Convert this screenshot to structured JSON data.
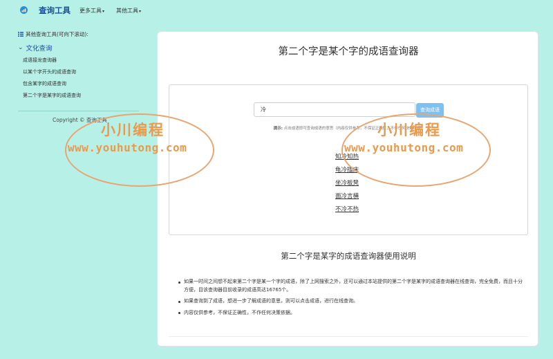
{
  "navbar": {
    "brand": "查询工具",
    "menus": [
      {
        "label": "更多工具"
      },
      {
        "label": "其他工具"
      }
    ]
  },
  "sidebar": {
    "hint": "其他查询工具(可向下滚动):",
    "group_label": "文化查询",
    "links": [
      {
        "label": "成语接龙查询器"
      },
      {
        "label": "以某个字开头的成语查询"
      },
      {
        "label": "包含某字的成语查询"
      },
      {
        "label": "第二个字是某字的成语查询"
      }
    ],
    "copyright": "Copyright © 查询工具"
  },
  "main": {
    "title": "第二个字是某个字的成语查询器",
    "search": {
      "value": "冷",
      "button_label": "查询成语"
    },
    "tip_label": "提示:",
    "tip_text": "点击成语即可查询成语的意思（内容仅供参考，不保证正确性，不作任何决策依据）",
    "results": [
      "知冷知热",
      "龟冷搘床",
      "坐冷板凳",
      "面冷言横",
      "不冷不热"
    ],
    "usage_title": "第二个字是某字的成语查询器使用说明",
    "usage_items": [
      "如果一时间之间想不起来第二个字是某一个字的成语，除了上网搜索之外，还可以通过本站提供的第二个字是某字的成语查询器在线查询，完全免费，而且十分方便，目该查询器目前收录的成语高达16765个。",
      "如果查询到了成语，想进一步了解成语的意思，则可以点击成语，进行在线查询。",
      "内容仅供参考，不保证正确性，不作任何决策依据。"
    ]
  },
  "watermark": {
    "top": "小川编程",
    "bottom": "www.youhutong.com"
  },
  "colors": {
    "background": "#b6f0e6",
    "brand": "#1d4fa0",
    "button": "#7cc1f2",
    "watermark": "#e89a4f"
  }
}
